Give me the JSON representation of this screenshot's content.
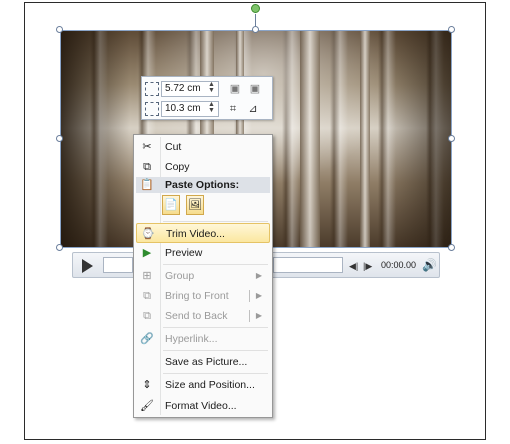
{
  "mini_toolbar": {
    "height_value": "5.72 cm",
    "width_value": "10.3 cm"
  },
  "player": {
    "time": "00:00.00"
  },
  "context_menu": {
    "cut": "Cut",
    "copy": "Copy",
    "paste_options": "Paste Options:",
    "trim_video": "Trim Video...",
    "preview": "Preview",
    "group": "Group",
    "bring_to_front": "Bring to Front",
    "send_to_back": "Send to Back",
    "hyperlink": "Hyperlink...",
    "save_as_picture": "Save as Picture...",
    "size_and_position": "Size and Position...",
    "format_video": "Format Video..."
  },
  "icons": {
    "cut": "scissors-icon",
    "copy": "copy-icon",
    "paste": "paste-icon",
    "trim": "trim-video-icon",
    "preview": "play-icon",
    "group": "group-icon",
    "bring": "bring-to-front-icon",
    "send": "send-to-back-icon",
    "hyperlink": "hyperlink-icon",
    "size": "size-position-icon",
    "format": "format-video-icon"
  },
  "colors": {
    "highlight": "#fbe7a0",
    "selection_frame": "#8aa4c8",
    "rotation_handle": "#7ec36a"
  }
}
